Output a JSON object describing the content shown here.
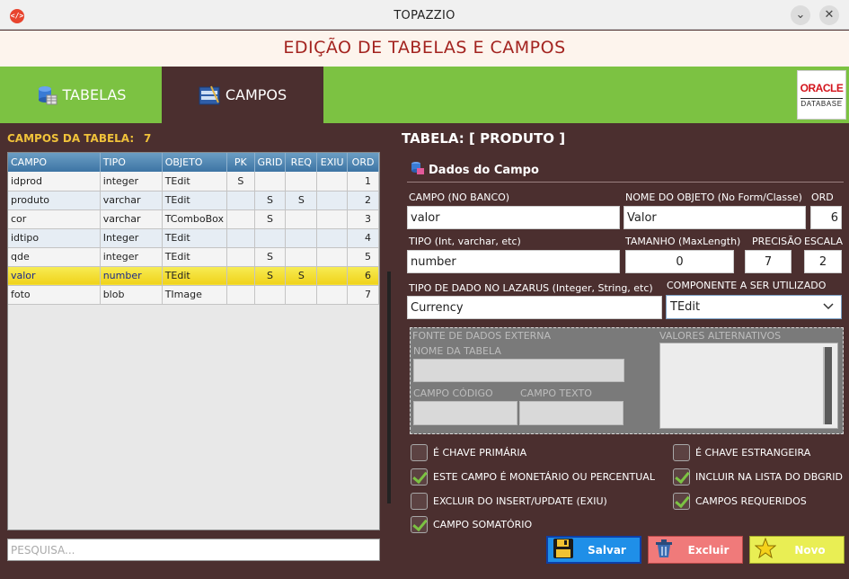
{
  "window": {
    "title": "TOPAZZIO",
    "minimize_glyph": "⌄",
    "close_glyph": "✕"
  },
  "header": {
    "title": "EDIÇÃO DE TABELAS E CAMPOS"
  },
  "tabs": [
    {
      "label": "TABELAS",
      "icon": "database-icon",
      "active": false
    },
    {
      "label": "CAMPOS",
      "icon": "form-fields-icon",
      "active": true
    }
  ],
  "logo": {
    "line1": "ORACLE",
    "line2": "DATABASE"
  },
  "left": {
    "campos_label": "CAMPOS DA TABELA:",
    "campos_count": "7",
    "columns": [
      "CAMPO",
      "TIPO",
      "OBJETO",
      "PK",
      "GRID",
      "REQ",
      "EXIU",
      "ORD"
    ],
    "rows": [
      {
        "campo": "idprod",
        "tipo": "integer",
        "objeto": "TEdit",
        "pk": "S",
        "grid": "",
        "req": "",
        "exiu": "",
        "ord": "1"
      },
      {
        "campo": "produto",
        "tipo": "varchar",
        "objeto": "TEdit",
        "pk": "",
        "grid": "S",
        "req": "S",
        "exiu": "",
        "ord": "2"
      },
      {
        "campo": "cor",
        "tipo": "varchar",
        "objeto": "TComboBox",
        "pk": "",
        "grid": "S",
        "req": "",
        "exiu": "",
        "ord": "3"
      },
      {
        "campo": "idtipo",
        "tipo": "Integer",
        "objeto": "TEdit",
        "pk": "",
        "grid": "",
        "req": "",
        "exiu": "",
        "ord": "4"
      },
      {
        "campo": "qde",
        "tipo": "integer",
        "objeto": "TEdit",
        "pk": "",
        "grid": "S",
        "req": "",
        "exiu": "",
        "ord": "5"
      },
      {
        "campo": "valor",
        "tipo": "number",
        "objeto": "TEdit",
        "pk": "",
        "grid": "S",
        "req": "S",
        "exiu": "",
        "ord": "6"
      },
      {
        "campo": "foto",
        "tipo": "blob",
        "objeto": "TImage",
        "pk": "",
        "grid": "",
        "req": "",
        "exiu": "",
        "ord": "7"
      }
    ],
    "selected_row": 5,
    "search_placeholder": "PESQUISA..."
  },
  "right": {
    "tabela_title": "TABELA: [ PRODUTO ]",
    "dados_title": "Dados do Campo",
    "fields": {
      "campo_label": "CAMPO (NO BANCO)",
      "campo_value": "valor",
      "nome_objeto_label": "NOME DO OBJETO (No Form/Classe)",
      "nome_objeto_value": "Valor",
      "ord_label": "ORD",
      "ord_value": "6",
      "tipo_label": "TIPO (Int, varchar, etc)",
      "tipo_value": "number",
      "tamanho_label": "TAMANHO (MaxLength)",
      "tamanho_value": "0",
      "precisao_label": "PRECISÃO",
      "precisao_value": "7",
      "escala_label": "ESCALA",
      "escala_value": "2",
      "tipo_lazarus_label": "TIPO DE DADO NO LAZARUS (Integer, String, etc)",
      "tipo_lazarus_value": "Currency",
      "componente_label": "COMPONENTE A SER UTILIZADO",
      "componente_value": "TEdit"
    },
    "externa": {
      "fonte_label": "FONTE DE DADOS EXTERNA",
      "nome_tabela_label": "NOME DA TABELA",
      "campo_codigo_label": "CAMPO CÓDIGO",
      "campo_texto_label": "CAMPO TEXTO",
      "valores_label": "VALORES ALTERNATIVOS"
    },
    "checks": [
      {
        "label": "É CHAVE PRIMÁRIA",
        "checked": false
      },
      {
        "label": "É CHAVE ESTRANGEIRA",
        "checked": false
      },
      {
        "label": "ESTE CAMPO É MONETÁRIO OU PERCENTUAL",
        "checked": true
      },
      {
        "label": "INCLUIR NA LISTA DO DBGRID",
        "checked": true
      },
      {
        "label": "EXCLUIR DO INSERT/UPDATE (EXIU)",
        "checked": false
      },
      {
        "label": "CAMPOS REQUERIDOS",
        "checked": true
      },
      {
        "label": "CAMPO SOMATÓRIO",
        "checked": true
      }
    ],
    "buttons": {
      "salvar": "Salvar",
      "excluir": "Excluir",
      "novo": "Novo"
    }
  },
  "colors": {
    "background": "#4b2f2f",
    "tab_green": "#7cc242",
    "accent_yellow": "#f0c23a",
    "header_red": "#a3231f"
  }
}
